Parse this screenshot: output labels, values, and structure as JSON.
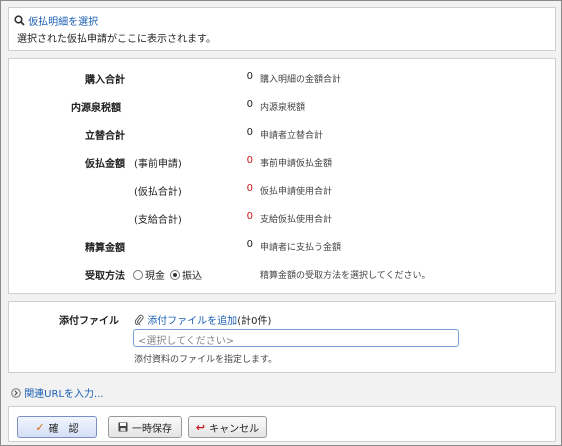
{
  "select": {
    "link_label": "仮払明細を選択",
    "message": "選択された仮払申請がここに表示されます。"
  },
  "amounts": {
    "rows": [
      {
        "label": "購入合計",
        "sub": "",
        "value": "0",
        "desc": "購入明細の金額合計"
      },
      {
        "label": "内源泉税額",
        "sub": "",
        "value": "0",
        "desc": "内源泉税額"
      },
      {
        "label": "立替合計",
        "sub": "",
        "value": "0",
        "desc": "申請者立替合計"
      },
      {
        "label": "仮払金額",
        "sub": "(事前申請)",
        "value": "0",
        "desc": "事前申請仮払金額"
      },
      {
        "label": "",
        "sub": "(仮払合計)",
        "value": "0",
        "desc": "仮払申請使用合計"
      },
      {
        "label": "",
        "sub": "(支給合計)",
        "value": "0",
        "desc": "支給仮払使用合計"
      },
      {
        "label": "精算金額",
        "sub": "",
        "value": "0",
        "desc": "申請者に支払う金額"
      }
    ],
    "receive": {
      "label": "受取方法",
      "option_cash": "現金",
      "option_transfer": "振込",
      "selected": "振込",
      "desc": "精算金額の受取方法を選択してください。"
    },
    "colors": {
      "value_red": "#d0161b"
    }
  },
  "attach": {
    "label": "添付ファイル",
    "add_link": "添付ファイルを追加",
    "count": "(計0件)",
    "placeholder": "<選択してください>",
    "help": "添付資料のファイルを指定します。"
  },
  "related_url": {
    "label": "関連URLを入力..."
  },
  "buttons": {
    "confirm": "確　認",
    "save_draft": "一時保存",
    "cancel": "キャンセル"
  }
}
